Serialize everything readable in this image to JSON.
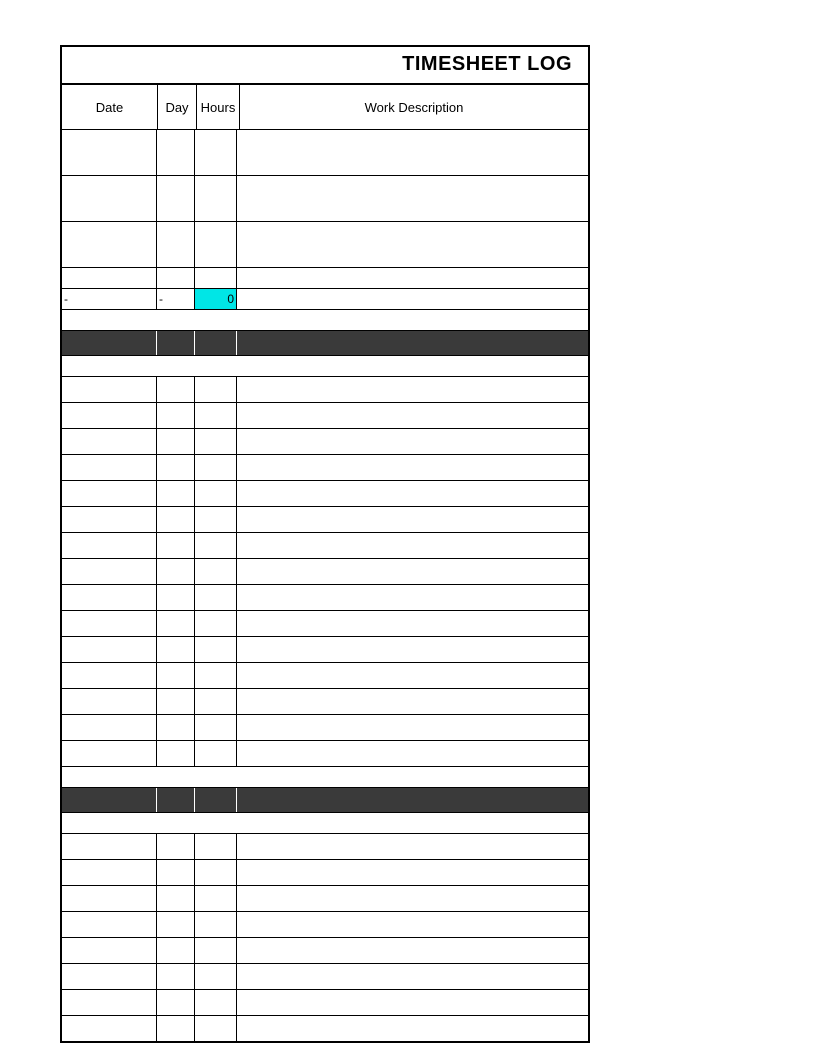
{
  "title": "TIMESHEET LOG",
  "headers": {
    "date": "Date",
    "day": "Day",
    "hours": "Hours",
    "desc": "Work Description"
  },
  "section1_summary": {
    "date": "-",
    "day": "-",
    "hours": "0",
    "desc": ""
  }
}
